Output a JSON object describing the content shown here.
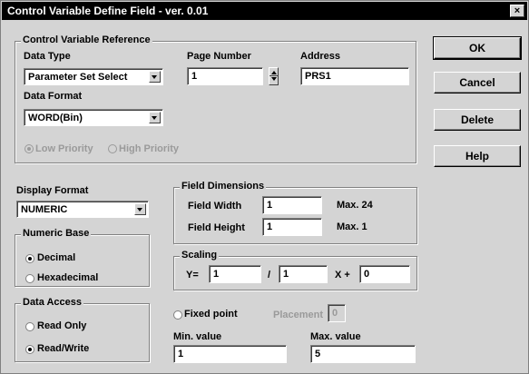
{
  "window": {
    "title": "Control Variable Define Field - ver. 0.01",
    "close_glyph": "×"
  },
  "cvr": {
    "title": "Control Variable Reference",
    "data_type": {
      "label": "Data Type",
      "value": "Parameter Set Select"
    },
    "page_number": {
      "label": "Page Number",
      "value": "1"
    },
    "address": {
      "label": "Address",
      "value": "PRS1"
    },
    "data_format": {
      "label": "Data Format",
      "value": "WORD(Bin)"
    },
    "priority": {
      "low": "Low Priority",
      "high": "High Priority",
      "selected": "low"
    }
  },
  "buttons": {
    "ok": "OK",
    "cancel": "Cancel",
    "delete": "Delete",
    "help": "Help"
  },
  "display_format": {
    "label": "Display Format",
    "value": "NUMERIC"
  },
  "numeric_base": {
    "title": "Numeric Base",
    "decimal": "Decimal",
    "hex": "Hexadecimal",
    "selected": "decimal"
  },
  "data_access": {
    "title": "Data Access",
    "read_only": "Read Only",
    "read_write": "Read/Write",
    "selected": "read_write"
  },
  "field_dimensions": {
    "title": "Field Dimensions",
    "width_label": "Field Width",
    "width_value": "1",
    "width_max": "Max.  24",
    "height_label": "Field Height",
    "height_value": "1",
    "height_max": "Max.  1"
  },
  "scaling": {
    "title": "Scaling",
    "y_label": "Y=",
    "numerator": "1",
    "slash": "/",
    "denominator": "1",
    "x_label": "X +",
    "offset": "0"
  },
  "fixed_point": {
    "label": "Fixed point",
    "placement_label": "Placement",
    "placement_value": "0",
    "checked": false
  },
  "range": {
    "min_label": "Min.  value",
    "min_value": "1",
    "max_label": "Max.  value",
    "max_value": "5"
  }
}
